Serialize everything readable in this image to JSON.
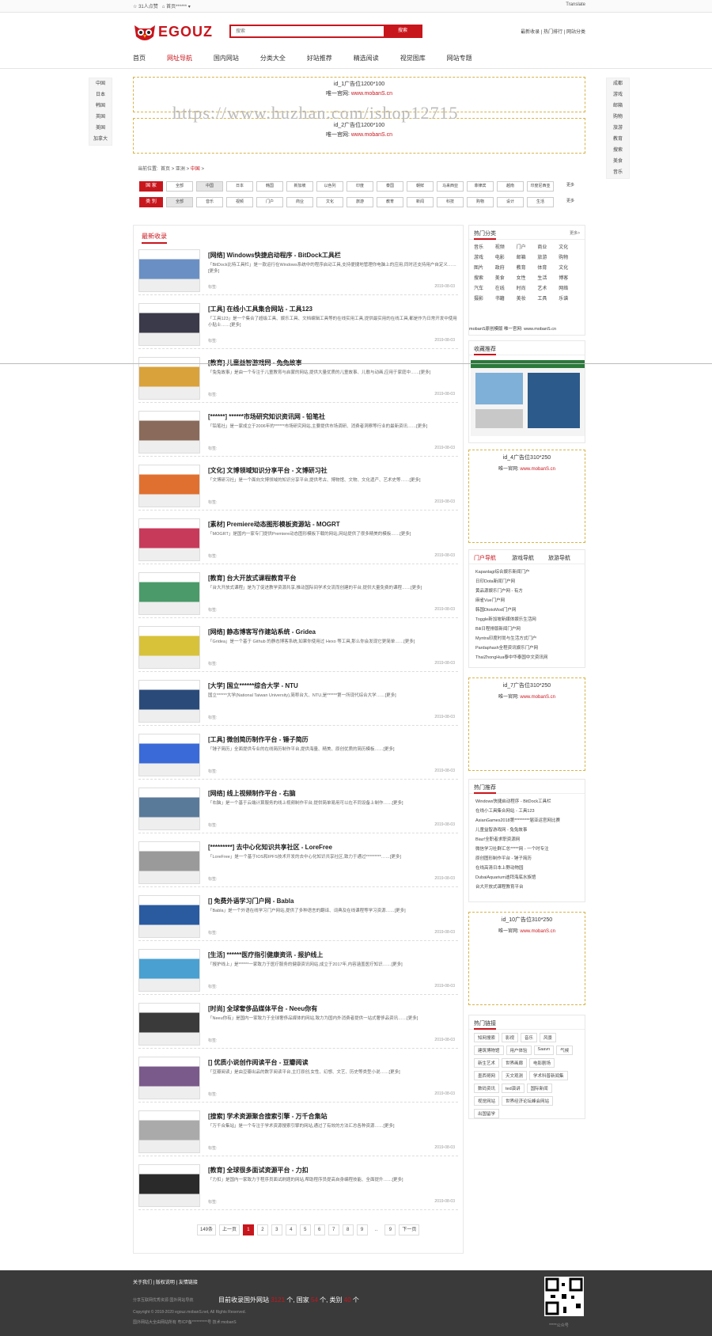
{
  "topbar": {
    "views": "31人点赞",
    "home": "首页******",
    "translate": "Translate"
  },
  "logo": {
    "text": "EGOUZ"
  },
  "search": {
    "placeholder": "搜索",
    "button": "搜索"
  },
  "header_links": {
    "a": "最新收录",
    "b": "热门排行",
    "c": "网站分类"
  },
  "nav": [
    "首页",
    "网址导航",
    "国内网站",
    "分类大全",
    "好站推荐",
    "精选阅读",
    "视觉图库",
    "网站专题"
  ],
  "left_flags": [
    "中国",
    "日本",
    "韩国",
    "英国",
    "美国",
    "加拿大"
  ],
  "right_flags": [
    "成都",
    "游戏",
    "邮箱",
    "购物",
    "旅游",
    "教育",
    "搜索",
    "美食",
    "音乐"
  ],
  "ad_top1": {
    "title": "id_1广告位1200*100",
    "line": "唯一官网:",
    "url": "www.mobanS.cn"
  },
  "ad_top2": {
    "title": "id_2广告位1200*100",
    "line": "唯一官网:",
    "url": "www.mobanS.cn"
  },
  "watermark": "https://www.huzhan.com/ishop12715",
  "breadcrumb": {
    "label": "当前位置:",
    "home": "首页",
    "sep": ">",
    "mid": "亚洲",
    "cur": "中国"
  },
  "filter1": {
    "label": "国 家",
    "chips": [
      "全部",
      "中国",
      "日本",
      "韩国",
      "新加坡",
      "以色列",
      "印度",
      "泰国",
      "朝鲜",
      "马来西亚",
      "菲律宾",
      "越南",
      "印度尼西亚",
      "更多"
    ]
  },
  "filter2": {
    "label": "类 别",
    "chips": [
      "全部",
      "音乐",
      "视频",
      "门户",
      "商业",
      "文化",
      "旅游",
      "教育",
      "新闻",
      "科技",
      "购物",
      "设计",
      "生活",
      "更多"
    ]
  },
  "main_title": "最新收录",
  "items": [
    {
      "title": "[网络] Windows快捷启动程序 - BitDock工具栏",
      "desc": "「BitDock比特工具栏」是一款运行在Windows系统中的程序启动工具,支持便捷地管理你电脑上的应用,同时还支持用户自定义……[更多]",
      "label": "标签:",
      "date": "2019-08-03"
    },
    {
      "title": "[工具] 在线小工具集合网站 - 工具123",
      "desc": "「工具123」是一个集合了超级工具、娱乐工具、文档编辑工具等的在线实用工具,提供最实用的在线工具,都是作为日常开发中使用小贴士……[更多]",
      "label": "标签:",
      "date": "2019-08-03"
    },
    {
      "title": "[教育] 儿童益智游戏网 - 兔兔故事",
      "desc": "「兔兔故事」是由一个专注于儿童教育与启蒙的网站,提供大量优质的儿童故事、儿歌与动画,应用于家庭中……[更多]",
      "label": "标签:",
      "date": "2019-08-03"
    },
    {
      "title": "[******] ******市场研究知识资讯网 - 铅笔社",
      "desc": "「铅笔社」是一家成立于2006年的******市场研究网站,主要提供市场调研、消费者洞察等行业的最新资讯……[更多]",
      "label": "标签:",
      "date": "2019-08-03"
    },
    {
      "title": "[文化] 文博领域知识分享平台 - 文博研习社",
      "desc": "「文博研习社」是一个面向文博领域的知识分享平台,提供考古、博物馆、文物、文化遗产、艺术史等……[更多]",
      "label": "标签:",
      "date": "2019-08-03"
    },
    {
      "title": "[素材] Premiere动态图形模板资源站 - MOGRT",
      "desc": "「MOGRT」是国内一家专门提供Premiere动态图形模板下载的网站,网站提供了很多精美的模板……[更多]",
      "label": "标签:",
      "date": "2019-08-03"
    },
    {
      "title": "[教育] 台大开放式课程教育平台",
      "desc": "「台大开放式课程」是为了促进教学资源共享,推动国际间学术交流而创建的平台,提供大量免费的课程……[更多]",
      "label": "标签:",
      "date": "2019-08-03"
    },
    {
      "title": "[网络] 静态博客写作建站系统 - Gridea",
      "desc": "「Gridea」是一个基于 Github 的静态博客系统,如果你使用过 Hexo 等工具,那么你会发现它更简单……[更多]",
      "label": "标签:",
      "date": "2019-08-03"
    },
    {
      "title": "[大学] 国立******综合大学 - NTU",
      "desc": "国立******大学(National Taiwan University),简称台大、NTU,是******第一所现代综合大学……[更多]",
      "label": "标签:",
      "date": "2019-08-03"
    },
    {
      "title": "[工具] 微创简历制作平台 - 锤子简历",
      "desc": "「锤子简历」全面提供专业的在线简历制作平台,提供海量、精美、原创优质的简历模板……[更多]",
      "label": "标签:",
      "date": "2019-08-03"
    },
    {
      "title": "[网络] 线上视频制作平台 - 右脑",
      "desc": "「右脑」是一个基于云端计算服务的线上视频制作平台,提供简单易用可以在不同设备上制作……[更多]",
      "label": "标签:",
      "date": "2019-08-03"
    },
    {
      "title": "[*********] 去中心化知识共享社区 - LoreFree",
      "desc": "「LoreFree」是一个基于IOS和IPFS技术开发的去中心化知识共享社区,致力于通过*********……[更多]",
      "label": "标签:",
      "date": "2019-08-03"
    },
    {
      "title": "[] 免费外语学习门户网 - Babla",
      "desc": "「Babla」是一个外语在线学习门户网站,提供了多种语言的翻译、词典及在线课程等学习资源……[更多]",
      "label": "标签:",
      "date": "2019-08-03"
    },
    {
      "title": "[生活] ******医疗指引健康资讯 - 报护线上",
      "desc": "「报护线上」是******一家致力于医疗服务的健康资讯网站,成立于2017年,内容涵盖医疗知识……[更多]",
      "label": "标签:",
      "date": "2019-08-03"
    },
    {
      "title": "[时尚] 全球奢侈品媒体平台 - Neeu你有",
      "desc": "「Neeu你有」是国内一家致力于全球奢侈品媒体的网站,致力为国内外消费者提供一站式奢侈品资讯……[更多]",
      "label": "标签:",
      "date": "2019-08-03"
    },
    {
      "title": "[] 优质小说创作阅读平台 - 豆瓣阅读",
      "desc": "「豆瓣阅读」是由豆瓣出品的数字阅读平台,主打原创,女性、幻想、文艺、历史等类型小说……[更多]",
      "label": "标签:",
      "date": "2019-08-03"
    },
    {
      "title": "[搜索] 学术资源聚合搜索引擎 - 万千合集站",
      "desc": "「万千合集站」是一个专注于学术资源搜索引擎的网站,通过了有效的方法汇总各种资源……[更多]",
      "label": "标签:",
      "date": "2019-08-03"
    },
    {
      "title": "[教育] 全球很多面试资源平台 - 力扣",
      "desc": "「力扣」是国内一家致力于程序员面试刷题的网站,帮助程序员提高自身编程技能、全面提升……[更多]",
      "label": "标签:",
      "date": "2019-08-03"
    }
  ],
  "pager": {
    "total": "149条",
    "prev": "上一页",
    "pages": [
      "1",
      "2",
      "3",
      "4",
      "5",
      "6",
      "7",
      "8",
      "9",
      "..",
      "9"
    ],
    "next": "下一页"
  },
  "side_cats": {
    "title": "热门分类",
    "more": "更多>",
    "items": [
      "音乐",
      "视频",
      "门户",
      "商业",
      "文化",
      "游戏",
      "电影",
      "邮箱",
      "旅游",
      "购物",
      "图片",
      "政府",
      "教育",
      "体育",
      "文化",
      "搜索",
      "美食",
      "女性",
      "生活",
      "博客",
      "汽车",
      "在线",
      "时尚",
      "艺术",
      "网络",
      "摄影",
      "书籍",
      "美妆",
      "工具",
      "乐谱"
    ]
  },
  "side_note": {
    "a": "mobanS原创模版",
    "b": "唯一官网:",
    "c": "www.mobanS.cn"
  },
  "side_collect": {
    "title": "收藏推荐"
  },
  "ad_side4": {
    "title": "id_4广告位310*250",
    "line": "唯一官网:",
    "url": "www.mobanS.cn"
  },
  "side_tabs": {
    "a": "门户导航",
    "b": "游戏导航",
    "c": "旅游导航",
    "items": [
      "Kapanlagi综合娱乐新闻门户",
      "日印Dota新闻门户网",
      "黄品源娱乐门户网 - 有方",
      "麻雀Vue门户网",
      "韩国DtotoMod门户网",
      "Toggle新加坡新媒体娱乐生活网",
      "Bili日程排版新闻门户网",
      "Myntra印度时尚与生活方式门户",
      "Pardaphash全程资讯娱乐门户网",
      "ThaiZhongHua泰中华泰国中文资讯网"
    ]
  },
  "ad_side7": {
    "title": "id_7广告位310*250",
    "line": "唯一官网:",
    "url": "www.mobanS.cn"
  },
  "side_hot": {
    "title": "热门推荐",
    "items": [
      "Windows快捷启动程序 - BitDock工具栏",
      "在线小工具集合网站 - 工具123",
      "AsianGames2018第*********届亚运官网比赛",
      "儿童益智游戏网 - 兔兔故事",
      "Biaz!全职者求职资源网",
      "微信学习社群汇总*****网 - 一个时专注",
      "原创图形制作平台 - 锤子简历",
      "在线高清日本上野动物园",
      "DubaiAquarium迪拜海底水族馆",
      "台大开放式课程教育平台"
    ]
  },
  "ad_side10": {
    "title": "id_10广告位310*250",
    "line": "唯一官网:",
    "url": "www.mobanS.cn"
  },
  "side_links": {
    "title": "热门链接",
    "items": [
      "知网搜索",
      "影视",
      "音乐",
      "风景",
      "建筑博物馆",
      "用户体验",
      "Saavn",
      "气候",
      "新生艺术",
      "世界画廊",
      "电影剧场",
      "墨西哥网",
      "天文观测",
      "学术科普新闻集",
      "数码资讯",
      "ted演讲",
      "国际新闻",
      "视觉网站",
      "世界经济论坛峰会网站",
      "出国留学"
    ]
  },
  "footer": {
    "links": [
      "关于我们",
      "版权说明",
      "友情链接"
    ],
    "stat_pre": "目前收录国外网站",
    "sites": "3121",
    "mid1": "个, 国家",
    "countries": "54",
    "mid2": "个, 类别",
    "cats": "40",
    "end": "个",
    "l1": "分享互联网优秀资源 国外网站导航",
    "l2": "Copyright © 2018-2020 egouz.mobanS.net, All Rights Reserved.",
    "l3": "国外网站大全由网站所有 粤ICP备**********号 技术:mobanS",
    "qr": "*****公众号"
  }
}
